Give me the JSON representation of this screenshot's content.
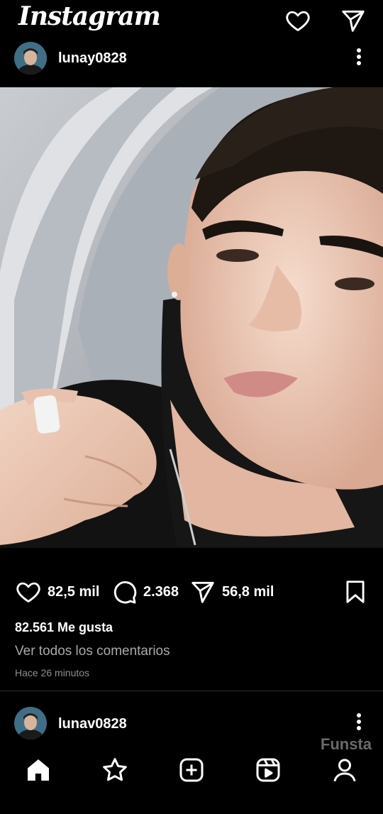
{
  "app": {
    "title": "Instagram"
  },
  "top_icons": [
    "heart-icon",
    "send-icon"
  ],
  "posts": [
    {
      "username": "lunay0828",
      "image": "selfie-photo",
      "likes_count": "82,5 mil",
      "comments_count": "2.368",
      "shares_count": "56,8 mil",
      "likes_text": "82.561 Me gusta",
      "view_comments": "Ver todos los comentarios",
      "time_ago": "Hace 26 minutos"
    },
    {
      "username": "lunav0828"
    }
  ],
  "watermark": "Funsta",
  "bottom_nav": [
    "home-icon",
    "star-icon",
    "add-post-icon",
    "reels-icon",
    "profile-icon"
  ],
  "colors": {
    "background": "#000000",
    "text": "#ffffff",
    "secondary_text": "#a8a8a8",
    "muted_text": "#8e8e8e"
  }
}
